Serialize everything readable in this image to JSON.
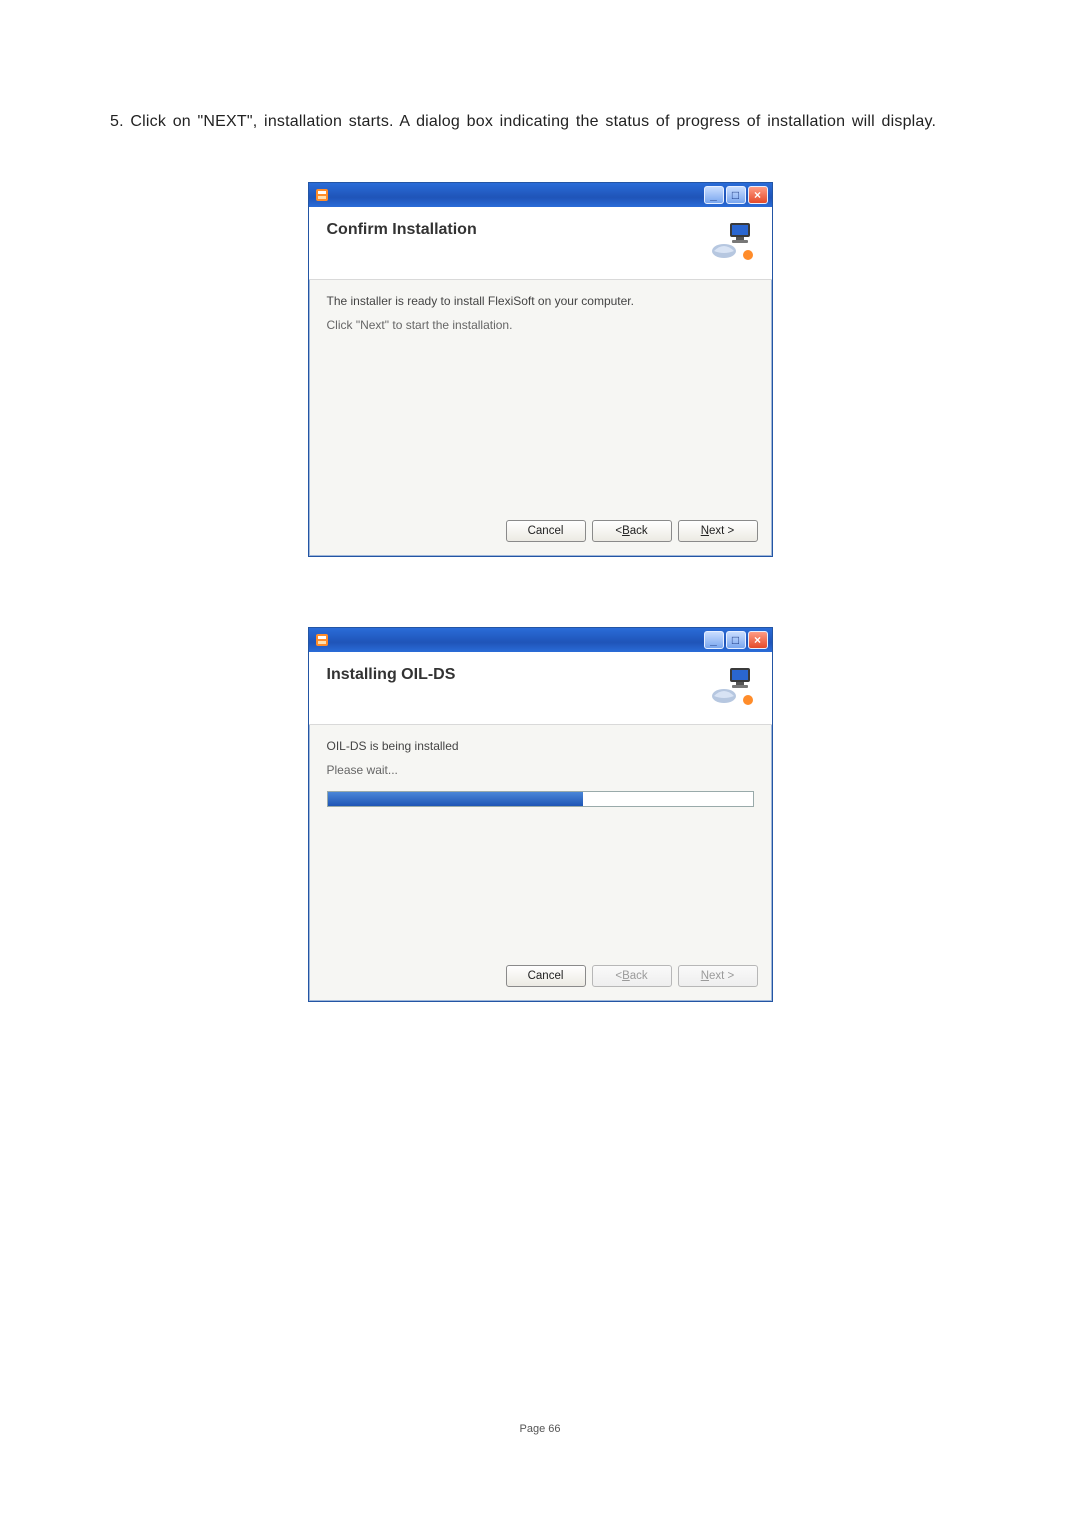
{
  "instruction_text": "5. Click on \"NEXT\", installation starts.  A dialog box indicating  the status of progress of installation  will display.",
  "dialog1": {
    "titlebar_text": "",
    "heading": "Confirm Installation",
    "body_line1": "The installer is ready to install FlexiSoft on your computer.",
    "body_line2": "Click \"Next\" to start the installation.",
    "buttons": {
      "cancel": "Cancel",
      "back_prefix": "< ",
      "back_u": "B",
      "back_suffix": "ack",
      "next_u": "N",
      "next_suffix": "ext >"
    }
  },
  "dialog2": {
    "titlebar_text": "",
    "heading": "Installing OIL-DS",
    "body_line1": "OIL-DS is being installed",
    "body_line2": "Please wait...",
    "progress_percent": 60,
    "buttons": {
      "cancel": "Cancel",
      "back_prefix": "< ",
      "back_u": "B",
      "back_suffix": "ack",
      "next_u": "N",
      "next_suffix": "ext >"
    }
  },
  "page_footer": "Page 66"
}
